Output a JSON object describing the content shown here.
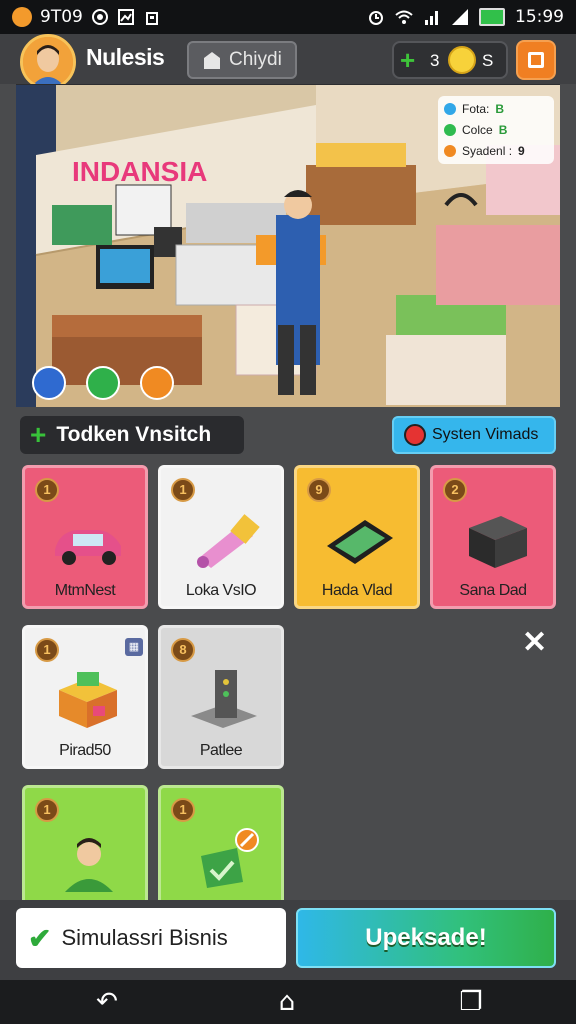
{
  "status": {
    "time_left": "9T09",
    "time_right": "15:99"
  },
  "header": {
    "player_name": "Nulesis",
    "city_label": "Chiydi",
    "plus_count": "3",
    "coin_count": "S"
  },
  "scene": {
    "sign": "INDANSIA",
    "info": [
      {
        "label": "Fota:",
        "value": "B",
        "color": "#31a7e8"
      },
      {
        "label": "Colce",
        "value": "B",
        "color": "#2fbb4f"
      },
      {
        "label": "Syadenl :",
        "value": "9",
        "color": "#f08a22"
      }
    ]
  },
  "section": {
    "label": "Todken Vnsitch",
    "system_button": "Systen Vimads"
  },
  "cards": [
    {
      "label": "MtmNest",
      "badge": "1"
    },
    {
      "label": "Loka VsIO",
      "badge": "1"
    },
    {
      "label": "Hada Vlad",
      "badge": "9"
    },
    {
      "label": "Sana Dad",
      "badge": "2"
    },
    {
      "label": "Pirad50",
      "badge": "1"
    },
    {
      "label": "Patlee",
      "badge": "8"
    },
    {
      "label": "",
      "badge": "1"
    },
    {
      "label": "",
      "badge": "1"
    }
  ],
  "buttons": {
    "simulate": "Simulassri Bisnis",
    "upgrade": "Upeksade!"
  },
  "icons": {
    "menu": "square-menu-icon",
    "close": "close-icon",
    "back": "back-icon",
    "home": "home-icon",
    "recents": "recents-icon"
  }
}
